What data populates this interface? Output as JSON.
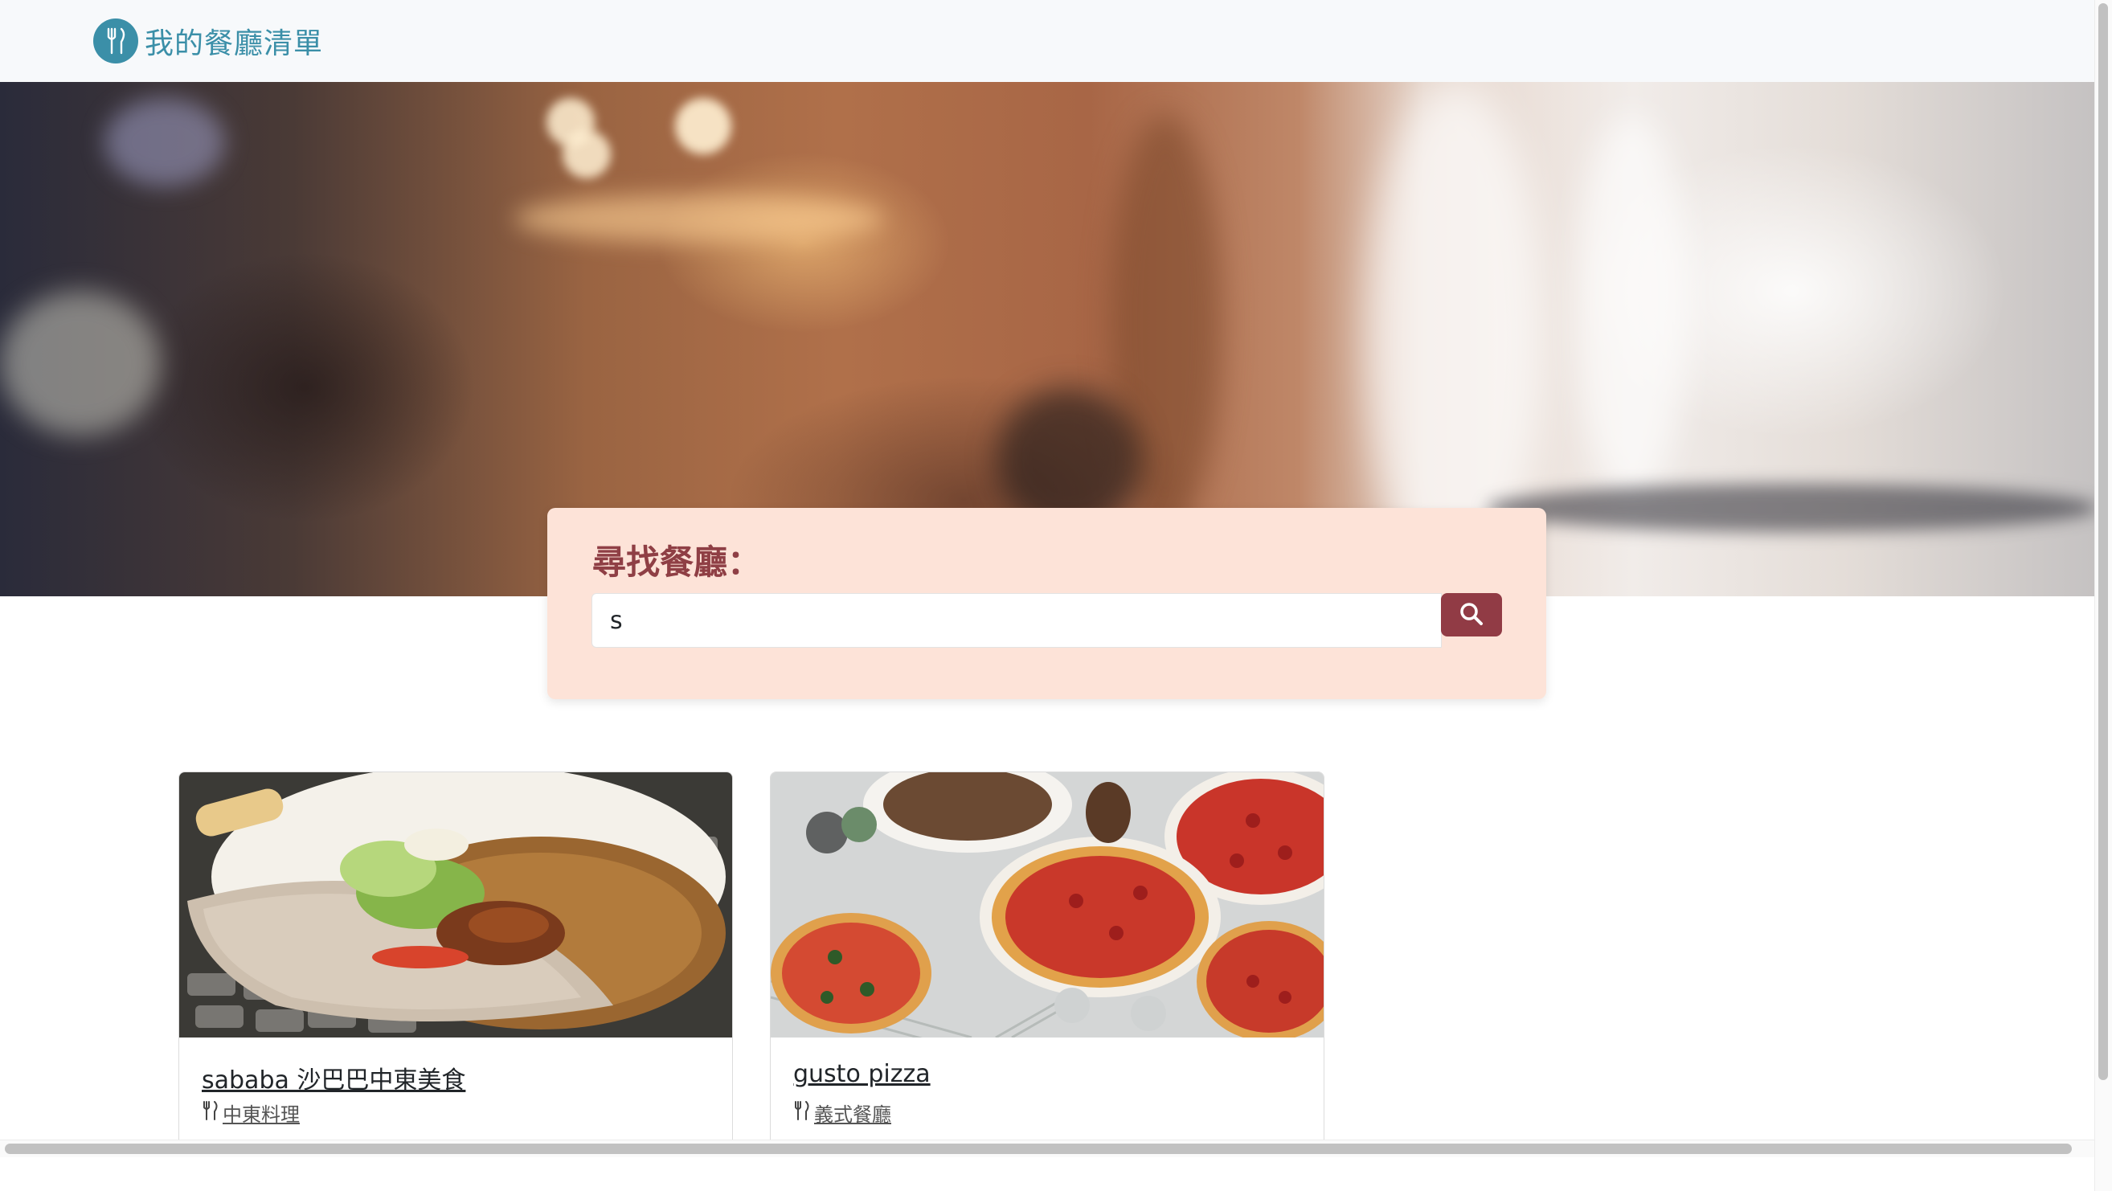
{
  "navbar": {
    "brand_text": "我的餐廳清單",
    "brand_icon": "utensils-icon"
  },
  "search": {
    "label": "尋找餐廳：",
    "input_value": "s",
    "button_icon": "search-icon"
  },
  "restaurants": [
    {
      "name": "sababa 沙巴巴中東美食",
      "category": "中東料理",
      "category_icon": "utensils-icon",
      "image": "pita-wrap-photo"
    },
    {
      "name": "gusto pizza",
      "category": "義式餐廳",
      "category_icon": "utensils-icon",
      "image": "pizza-photo"
    }
  ],
  "colors": {
    "brand": "#3b8fa8",
    "search_panel": "#fde3d8",
    "search_label": "#8f3f45",
    "search_button": "#913b45"
  }
}
